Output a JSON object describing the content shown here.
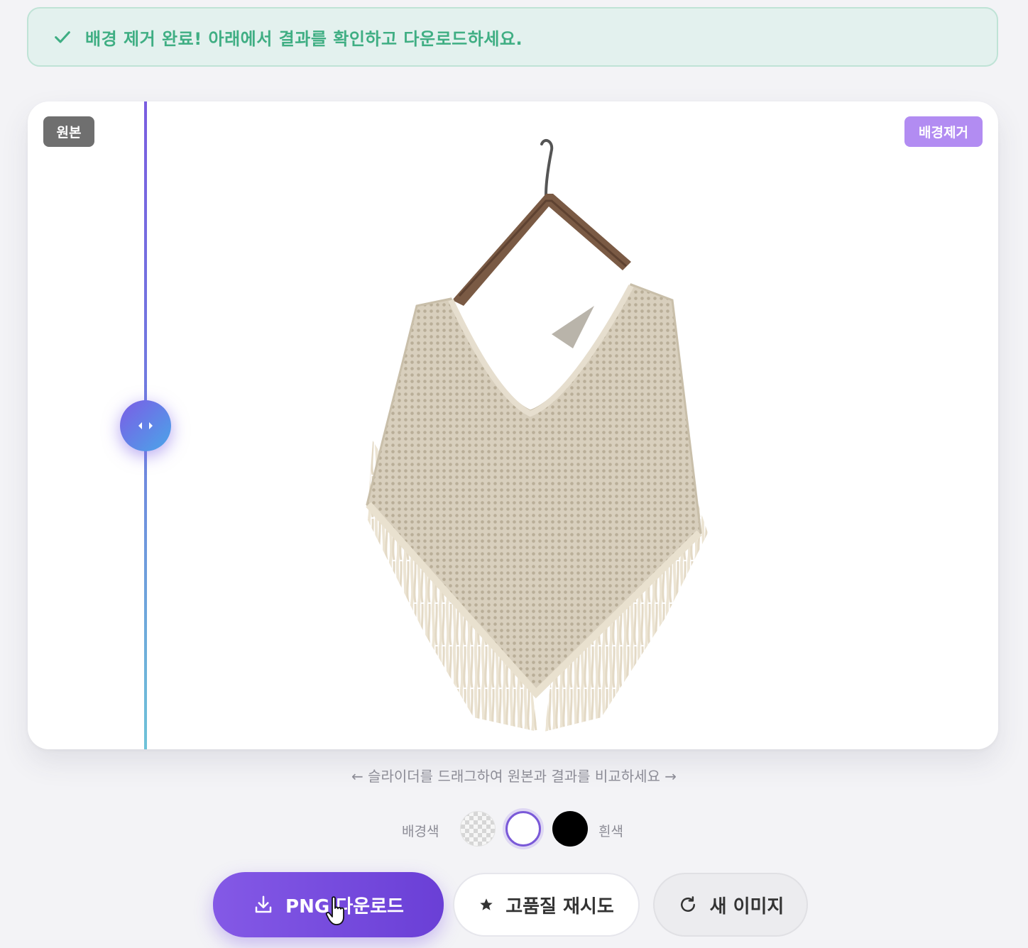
{
  "banner": {
    "icon": "check-icon",
    "message": "배경 제거 완료! 아래에서 결과를 확인하고 다운로드하세요."
  },
  "compare": {
    "label_original": "원본",
    "label_removed": "배경제거",
    "hint": "← 슬라이더를 드래그하여 원본과 결과를 비교하세요 →"
  },
  "background": {
    "label": "배경색",
    "options": [
      {
        "name": "transparent",
        "color": "checkerboard"
      },
      {
        "name": "white",
        "color": "#ffffff"
      },
      {
        "name": "black",
        "color": "#000000"
      }
    ],
    "selected_label": "흰색"
  },
  "actions": {
    "download_label": "PNG 다운로드",
    "download_icon": "download-icon",
    "retry_label": "고품질 재시도",
    "retry_icon": "star-icon",
    "new_label": "새 이미지",
    "new_icon": "refresh-icon"
  },
  "colors": {
    "success_text": "#3fae83",
    "success_bg": "#e3f1ee",
    "accent": "#7a59d8",
    "tag_removed": "#b28cf2",
    "tag_original": "#6f6f6f"
  }
}
